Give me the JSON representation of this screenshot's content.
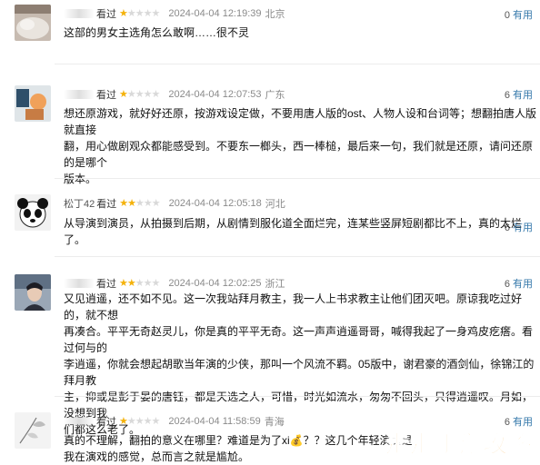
{
  "reviews": [
    {
      "username": "",
      "watched": "看过",
      "rating": 1,
      "date": "2024-04-04 12:19:39",
      "location": "北京",
      "useful_count": "0",
      "useful_label": "有用",
      "content": [
        "这部的男女主选角怎么敢啊……很不灵"
      ]
    },
    {
      "username": "",
      "watched": "看过",
      "rating": 1,
      "date": "2024-04-04 12:07:53",
      "location": "广东",
      "useful_count": "6",
      "useful_label": "有用",
      "content": [
        "想还原游戏，就好好还原，按游戏设定做，不要用唐人版的ost、人物人设和台词等；想翻拍唐人版就直接",
        "翻，用心做剧观众都能感受到。不要东一榔头，西一棒槌，最后来一句，我们就是还原，请问还原的是哪个",
        "版本。"
      ]
    },
    {
      "username": "松丁42",
      "watched": "看过",
      "rating": 2,
      "date": "2024-04-04 12:05:18",
      "location": "河北",
      "useful_count": "6",
      "useful_label": "有用",
      "content": [
        "从导演到演员，从拍摄到后期，从剧情到服化道全面烂完，连某些竖屏短剧都比不上，真的太烂了。"
      ]
    },
    {
      "username": "",
      "watched": "看过",
      "rating": 2,
      "date": "2024-04-04 12:02:25",
      "location": "浙江",
      "useful_count": "6",
      "useful_label": "有用",
      "content": [
        "又见逍遥，还不如不见。这一次我站拜月教主，我一人上书求教主让他们团灭吧。原谅我吃过好的，就不想",
        "再凑合。平平无奇赵灵儿，你是真的平平无奇。这一声声逍遥哥哥，喊得我起了一身鸡皮疙瘩。看过何与的",
        "李逍遥，你就会想起胡歌当年演的少侠，那叫一个风流不羁。05版中，谢君豪的酒剑仙，徐锦江的拜月教",
        "主，抑或是彭于晏的唐钰，都是天选之人，可惜，时光如流水，匆匆不回头，只得逍遥叹。月如，没想到我",
        "们都这么老了。"
      ]
    },
    {
      "username": "",
      "watched": "看过",
      "rating": 1,
      "date": "2024-04-04 11:58:59",
      "location": "青海",
      "useful_count": "6",
      "useful_label": "有用",
      "content": [
        "真的不理解，翻拍的意义在哪里？难道是为了xi💰？？这几个年轻演员是",
        "我在演戏的感觉，总而言之就是尴尬。"
      ]
    }
  ],
  "watermark": "走走手游攻略",
  "colors": {
    "star_on": "#f4b20b",
    "star_off": "#d9d9d9",
    "link": "#3377aa",
    "meta": "#8a8a8a"
  }
}
